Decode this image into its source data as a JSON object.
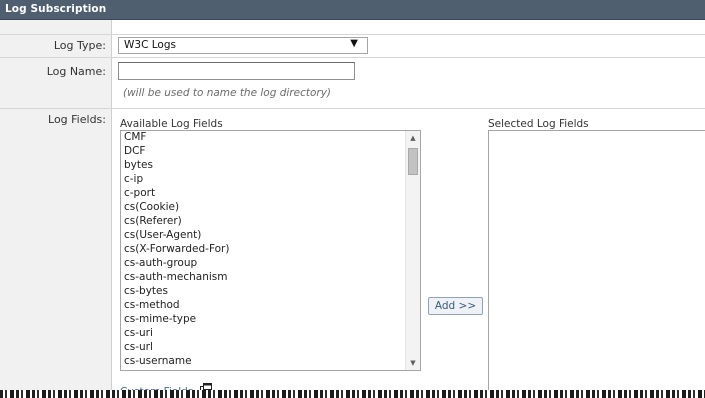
{
  "panel": {
    "title": "Log Subscription"
  },
  "log_type": {
    "label": "Log Type:",
    "selected": "W3C Logs",
    "arrow": "▼"
  },
  "log_name": {
    "label": "Log Name:",
    "value": "",
    "hint": "(will be used to name the log directory)"
  },
  "log_fields": {
    "label": "Log Fields:",
    "available_caption": "Available Log Fields",
    "selected_caption": "Selected Log Fields",
    "available": [
      "CMF",
      "DCF",
      "bytes",
      "c-ip",
      "c-port",
      "cs(Cookie)",
      "cs(Referer)",
      "cs(User-Agent)",
      "cs(X-Forwarded-For)",
      "cs-auth-group",
      "cs-auth-mechanism",
      "cs-bytes",
      "cs-method",
      "cs-mime-type",
      "cs-uri",
      "cs-url",
      "cs-username"
    ],
    "selected": [],
    "add_label": "Add >>",
    "custom_fields_label": "Custom Fields",
    "custom_fields_icon": "popup-window-icon",
    "scrollbar_up_icon": "▲",
    "scrollbar_down_icon": "▼"
  }
}
